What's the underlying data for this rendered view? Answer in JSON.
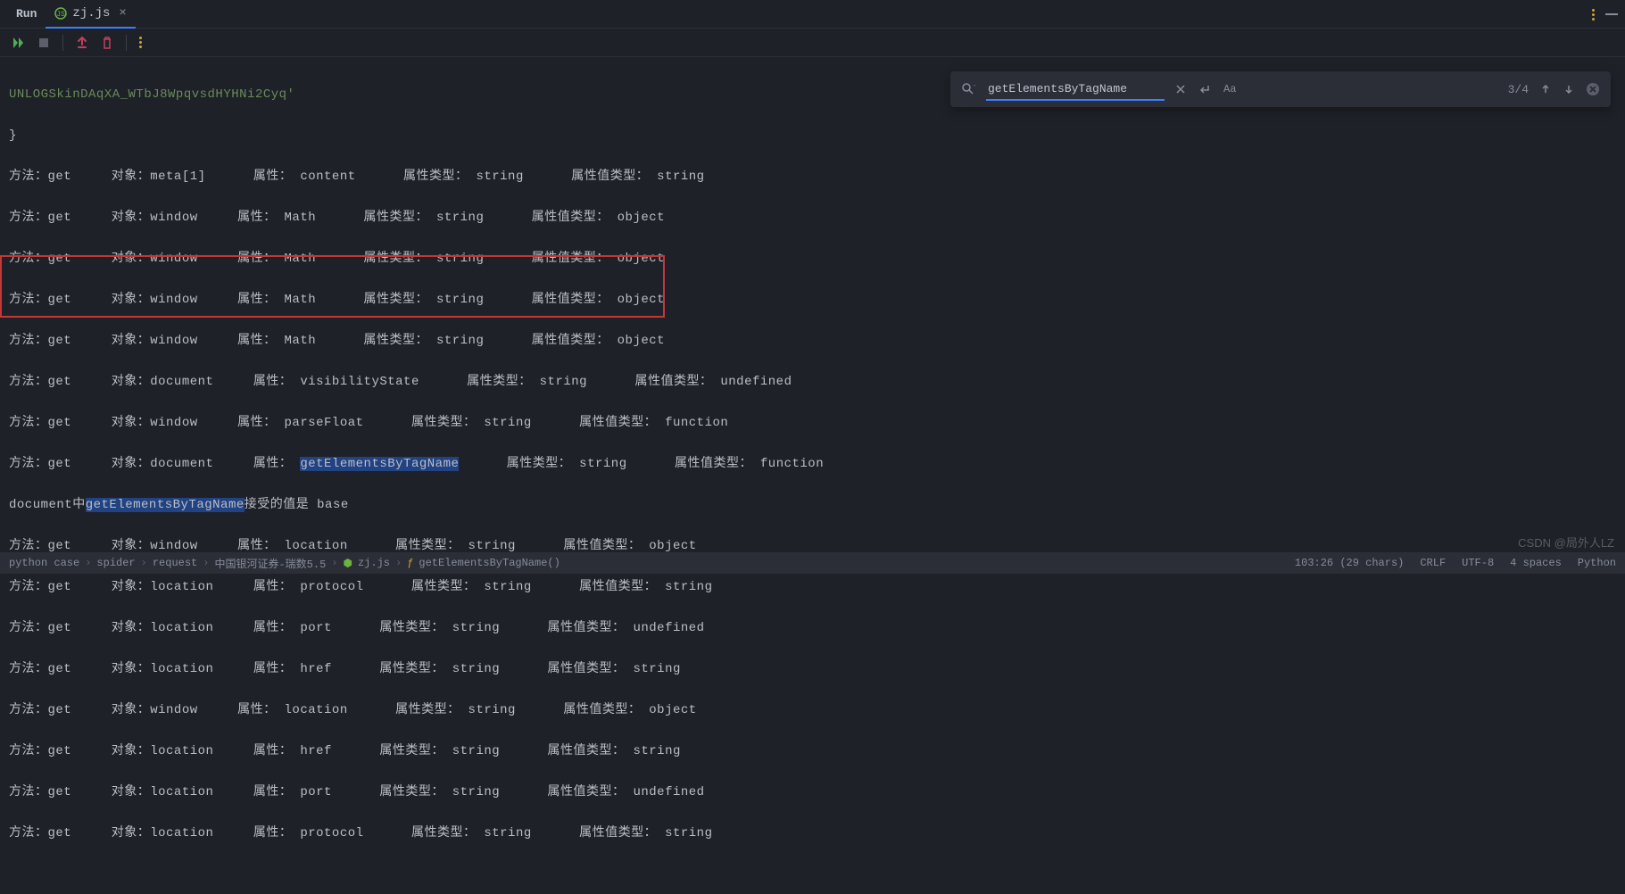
{
  "tabbar": {
    "run_label": "Run",
    "tab_name": "zj.js",
    "tab_close": "×"
  },
  "toolbar": {
    "run_icon": "run",
    "stop_icon": "stop",
    "arrow_up_icon": "arrow-up",
    "trash_icon": "trash",
    "more_icon": "more"
  },
  "find": {
    "value": "getElementsByTagName",
    "count": "3/4",
    "match_case": "Aa"
  },
  "console": {
    "line1": "UNLOGSkinDAqXA_WTbJ8WpqvsdHYHNi2Cyq'",
    "line2": "}",
    "lines": [
      "方法：get     对象：meta[1]      属性： content      属性类型： string      属性值类型： string",
      "方法：get     对象：window     属性： Math      属性类型： string      属性值类型： object",
      "方法：get     对象：window     属性： Math      属性类型： string      属性值类型： object",
      "方法：get     对象：window     属性： Math      属性类型： string      属性值类型： object",
      "方法：get     对象：window     属性： Math      属性类型： string      属性值类型： object",
      "方法：get     对象：document     属性： visibilityState      属性类型： string      属性值类型： undefined",
      "方法：get     对象：window     属性： parseFloat      属性类型： string      属性值类型： function"
    ],
    "hl_line1_pre": "方法：get     对象：document     属性： ",
    "hl_line1_sel": "getElementsByTagName",
    "hl_line1_post": "      属性类型： string      属性值类型： function",
    "hl_line2_pre": "document中",
    "hl_line2_sel": "getElementsByTagName",
    "hl_line2_post": "接受的值是 base",
    "lines_after": [
      "方法：get     对象：window     属性： location      属性类型： string      属性值类型： object",
      "方法：get     对象：location     属性： protocol      属性类型： string      属性值类型： string",
      "方法：get     对象：location     属性： port      属性类型： string      属性值类型： undefined",
      "方法：get     对象：location     属性： href      属性类型： string      属性值类型： string",
      "方法：get     对象：window     属性： location      属性类型： string      属性值类型： object",
      "方法：get     对象：location     属性： href      属性类型： string      属性值类型： string",
      "方法：get     对象：location     属性： port      属性类型： string      属性值类型： undefined",
      "方法：get     对象：location     属性： protocol      属性类型： string      属性值类型： string"
    ]
  },
  "status": {
    "breadcrumb": [
      "python case",
      "spider",
      "request",
      "中国银河证券-瑞数5.5",
      "zj.js",
      "getElementsByTagName()"
    ],
    "pos": "103:26 (29 chars)",
    "le": "CRLF",
    "enc": "UTF-8",
    "indent": "4 spaces",
    "lang": "Python"
  },
  "watermark": "CSDN @局外人LZ"
}
